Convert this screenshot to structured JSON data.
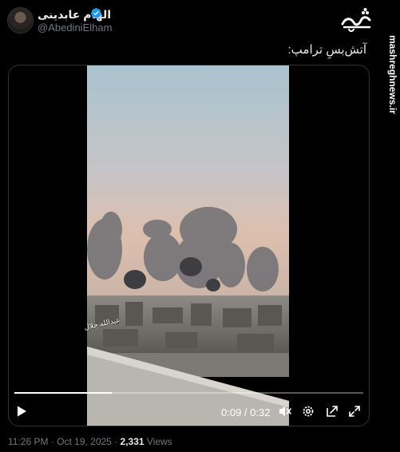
{
  "tweet": {
    "author": {
      "display_name": "الهام عابدینی",
      "handle": "@AbediniElham",
      "verified": true
    },
    "text": "آتش‌بسِ ترامپ:",
    "timestamp": "11:26 PM · Oct 19, 2025 · ",
    "views_count": "2,331",
    "views_label": " Views"
  },
  "watermark": {
    "logo_text": "مشرق",
    "site": "mashreghnews.ir"
  },
  "video": {
    "overlay_caption": "عبدالله جلال",
    "time_current": "0:09",
    "time_total": "0:32",
    "time_display": "0:09 / 0:32",
    "progress_percent": 28,
    "icons": [
      "play-icon",
      "mute-icon",
      "settings-icon",
      "popout-icon",
      "fullscreen-icon"
    ]
  },
  "colors": {
    "background": "#000000",
    "text_primary": "#e7e9ea",
    "text_secondary": "#71767b",
    "verified": "#1d9bf0",
    "border": "#2f3336"
  }
}
